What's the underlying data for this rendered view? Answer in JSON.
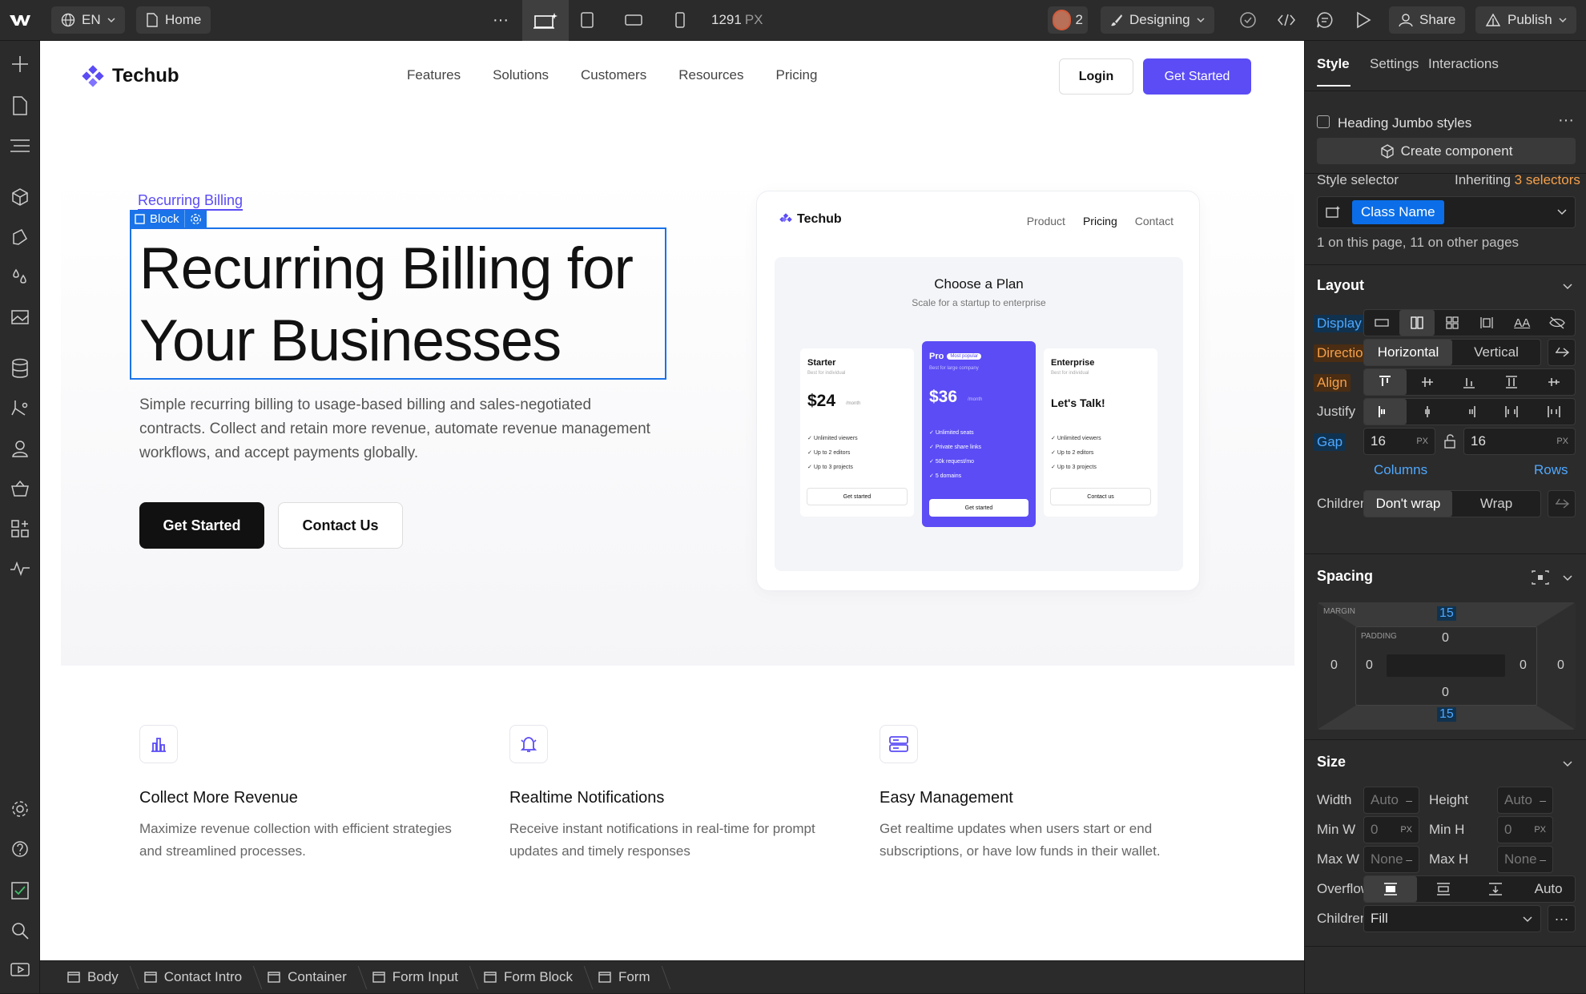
{
  "topbar": {
    "locale": "EN",
    "page": "Home",
    "width_value": "1291",
    "width_unit": "PX",
    "collaborators": "2",
    "mode": "Designing",
    "share": "Share",
    "publish": "Publish"
  },
  "site": {
    "brand": "Techub",
    "nav": [
      "Features",
      "Solutions",
      "Customers",
      "Resources",
      "Pricing"
    ],
    "login": "Login",
    "get_started": "Get Started",
    "eyebrow": "Recurring Billing",
    "block_label": "Block",
    "heading_line1": "Recurring Billing for",
    "heading_line2": "Your Businesses",
    "lede": "Simple recurring billing to usage-based billing and sales-negotiated contracts. Collect and retain more revenue, automate revenue management workflows, and accept payments globally.",
    "cta_primary": "Get Started",
    "cta_secondary": "Contact Us",
    "preview": {
      "brand": "Techub",
      "nav": [
        "Product",
        "Pricing",
        "Contact"
      ],
      "title": "Choose a Plan",
      "subtitle": "Scale for a startup to enterprise",
      "plans": [
        {
          "name": "Starter",
          "desc": "Best for individual",
          "price": "$24",
          "per": "/month",
          "features": [
            "Unlimited viewers",
            "Up to 2 editors",
            "Up to 3 projects"
          ],
          "cta": "Get started"
        },
        {
          "name": "Pro",
          "badge": "Most popular",
          "desc": "Best for large company",
          "price": "$36",
          "per": "/month",
          "features": [
            "Unlimited seats",
            "Private share links",
            "50k request/mo",
            "5 domains"
          ],
          "cta": "Get started"
        },
        {
          "name": "Enterprise",
          "desc": "Best for individual",
          "price": "Let's Talk!",
          "features": [
            "Unlimited viewers",
            "Up to 2 editors",
            "Up to 3 projects"
          ],
          "cta": "Contact us"
        }
      ]
    },
    "features": [
      {
        "icon": "bar-chart-icon",
        "title": "Collect More Revenue",
        "text": "Maximize revenue collection with efficient strategies and streamlined processes."
      },
      {
        "icon": "bell-icon",
        "title": "Realtime Notifications",
        "text": "Receive instant notifications in real-time for prompt updates and timely responses"
      },
      {
        "icon": "server-icon",
        "title": "Easy Management",
        "text": "Get realtime updates when users start or end subscriptions, or have low funds in their wallet."
      }
    ]
  },
  "breadcrumb": [
    "Body",
    "Contact Intro",
    "Container",
    "Form Input",
    "Form Block",
    "Form"
  ],
  "panel": {
    "tabs": [
      "Style",
      "Settings",
      "Interactions"
    ],
    "style_name": "Heading Jumbo styles",
    "create_component": "Create component",
    "selector_label": "Style selector",
    "inheriting_prefix": "Inheriting",
    "inheriting_count": "3 selectors",
    "class_name": "Class Name",
    "usage": "1 on this page, 11 on other pages",
    "layout": {
      "title": "Layout",
      "display": "Display",
      "direction": "Direction",
      "horizontal": "Horizontal",
      "vertical": "Vertical",
      "align": "Align",
      "justify": "Justify",
      "gap": "Gap",
      "gap_col": "16",
      "gap_row": "16",
      "unit": "PX",
      "columns": "Columns",
      "rows": "Rows",
      "children": "Children",
      "dont_wrap": "Don't wrap",
      "wrap": "Wrap"
    },
    "spacing": {
      "title": "Spacing",
      "margin": "MARGIN",
      "padding": "PADDING",
      "m_top": "15",
      "m_bottom": "15",
      "m_left": "0",
      "m_right": "0",
      "p_top": "0",
      "p_bottom": "0",
      "p_left": "0",
      "p_right": "0"
    },
    "size": {
      "title": "Size",
      "width": "Width",
      "height": "Height",
      "auto": "Auto",
      "min_w": "Min W",
      "min_h": "Min H",
      "zero": "0",
      "max_w": "Max W",
      "max_h": "Max H",
      "none": "None",
      "overflow": "Overflow",
      "overflow_auto": "Auto",
      "children": "Children",
      "fill": "Fill"
    }
  },
  "colors": {
    "accent": "#5b4cf5",
    "selection": "#1a73e8",
    "panel_blue": "#0b6ee8"
  }
}
